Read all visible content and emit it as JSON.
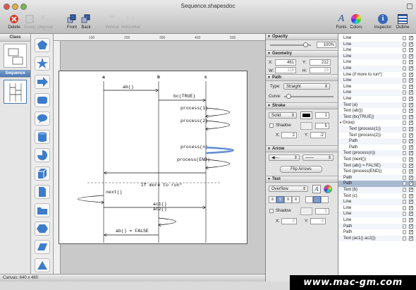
{
  "window": {
    "title": "Sequence.shapesdoc"
  },
  "toolbar": {
    "delete": "Delete",
    "group": "Group",
    "ungroup": "Ungroup",
    "front": "Front",
    "back": "Back",
    "vertical": "Vertical",
    "horizontal": "Horizontal",
    "fonts": "Fonts",
    "colors": "Colors",
    "inspector": "Inspector",
    "outline": "Outline"
  },
  "left": {
    "class_label": "Class",
    "sequence_label": "Sequence"
  },
  "status": {
    "canvas": "Canvas: 640 x 480"
  },
  "ruler": {
    "h": [
      "100",
      "200",
      "300",
      "400",
      "500"
    ],
    "v": [
      "100",
      "200",
      "300",
      "400"
    ]
  },
  "diagram": {
    "lifelines": [
      "a",
      "b",
      "c"
    ],
    "messages": [
      "ab()",
      "bc(TRUE)",
      "process(1)",
      "process(2)",
      "process(n)",
      "process(END)",
      "next()",
      "ac1()",
      "ac2()",
      "ab() = FALSE"
    ],
    "loop": "If more to run*"
  },
  "inspector": {
    "opacity": {
      "title": "Opacity",
      "value": "100%"
    },
    "geometry": {
      "title": "Geometry",
      "x_label": "X:",
      "x": "461",
      "y_label": "Y:",
      "y": "212",
      "w_label": "W:",
      "w": "118",
      "h_label": "H:",
      "h": "23"
    },
    "path": {
      "title": "Path",
      "type_label": "Type:",
      "type": "Straight",
      "curve_label": "Curve:"
    },
    "stroke": {
      "title": "Stroke",
      "style": "Solid",
      "width": "1",
      "shadow_label": "Shadow",
      "shadow": "5",
      "x_label": "X:",
      "x": "2",
      "y_label": "Y:",
      "y": "-2"
    },
    "arrow": {
      "title": "Arrow",
      "flip": "Flip Arrows"
    },
    "text": {
      "title": "Text",
      "overflow": "Overflow",
      "font_glyph": "A",
      "shadow_label": "Shadow",
      "shadow": "5",
      "x_label": "X:",
      "x": "0",
      "y_label": "Y:",
      "y": "0"
    }
  },
  "layers": [
    "Line",
    "Line",
    "Line",
    "Line",
    "Line",
    "Line",
    "Line (if more to run*)",
    "Line",
    "Line",
    "Line",
    "Line",
    "Text (a)",
    "Text (ab())",
    "Text (bc(TRUE))",
    "Group",
    "Text (process(1))",
    "Text (process(2))",
    "Path",
    "Path",
    "Text (process(n))",
    "Text (next())",
    "Text (ab() = FALSE)",
    "Text (process(END))",
    "Path",
    "Path",
    "Text (b)",
    "Text (c)",
    "Line",
    "Line",
    "Line",
    "Line",
    "Path",
    "Path",
    "Text (ac1() ac2())"
  ],
  "layers_selected": 24,
  "watermark": "www.mac-gm.com"
}
